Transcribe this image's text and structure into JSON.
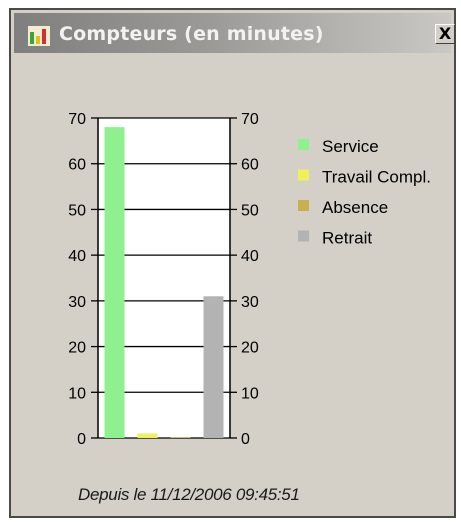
{
  "window": {
    "title": "Compteurs (en minutes)",
    "title_icon": "bar-chart-icon",
    "close_label": "X",
    "close_icon": "close-icon"
  },
  "chart_data": {
    "type": "bar",
    "title": "",
    "categories": [
      "Service",
      "Travail Compl.",
      "Absence",
      "Retrait"
    ],
    "values": [
      68,
      1,
      0,
      31
    ],
    "colors": [
      "#8ef08e",
      "#f0f05a",
      "#c8b050",
      "#b3b3b3"
    ],
    "ylim": [
      0,
      70
    ],
    "yticks": [
      0,
      10,
      20,
      30,
      40,
      50,
      60,
      70
    ],
    "legend_position": "right",
    "grid": true
  },
  "footer": {
    "text": "Depuis le 11/12/2006 09:45:51"
  }
}
